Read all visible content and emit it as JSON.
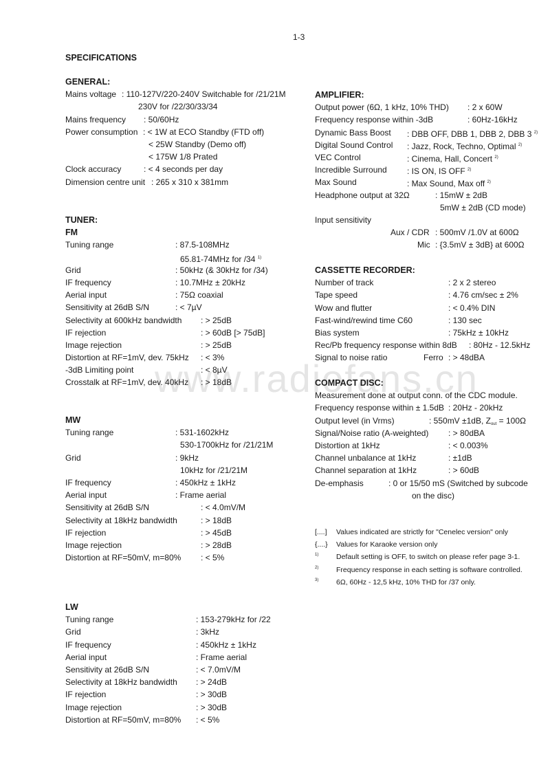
{
  "page_number": "1-3",
  "title": "SPECIFICATIONS",
  "watermark": "www.radiofans.cn",
  "general": {
    "heading": "GENERAL:",
    "rows": [
      {
        "label": "Mains voltage",
        "value": ": 110-127V/220-240V Switchable for /21/21M"
      },
      {
        "label": "",
        "value": "230V for /22/30/33/34"
      },
      {
        "label": "Mains frequency",
        "value": ": 50/60Hz"
      },
      {
        "label": "Power consumption",
        "value": ": < 1W at ECO Standby (FTD off)"
      },
      {
        "label": "",
        "value": "< 25W Standby (Demo off)"
      },
      {
        "label": "",
        "value": "< 175W 1/8 Prated"
      },
      {
        "label": "Clock accuracy",
        "value": ": < 4 seconds per day"
      },
      {
        "label": "Dimension centre unit",
        "value": ": 265 x 310 x 381mm"
      }
    ]
  },
  "tuner": {
    "heading": "TUNER:",
    "fm": {
      "heading": "FM",
      "rows": [
        {
          "label": "Tuning range",
          "value": ": 87.5-108MHz"
        },
        {
          "label": "",
          "value": "65.81-74MHz for /34",
          "note": "1)"
        },
        {
          "label": "Grid",
          "value": ": 50kHz (& 30kHz for /34)"
        },
        {
          "label": "IF frequency",
          "value": ": 10.7MHz ± 20kHz"
        },
        {
          "label": "Aerial input",
          "value": ": 75Ω coaxial"
        },
        {
          "label": "Sensitivity at 26dB S/N",
          "value": ": < 7µV"
        },
        {
          "label": "Selectivity at 600kHz bandwidth",
          "value": ": > 25dB"
        },
        {
          "label": "IF rejection",
          "value": ": > 60dB [> 75dB]"
        },
        {
          "label": "Image rejection",
          "value": ": > 25dB"
        },
        {
          "label": "Distortion at RF=1mV, dev. 75kHz",
          "value": ": < 3%"
        },
        {
          "label": "-3dB Limiting point",
          "value": ": < 8µV"
        },
        {
          "label": "Crosstalk at RF=1mV, dev. 40kHz",
          "value": ": > 18dB"
        }
      ]
    },
    "mw": {
      "heading": "MW",
      "rows": [
        {
          "label": "Tuning range",
          "value": ": 531-1602kHz"
        },
        {
          "label": "",
          "value": "530-1700kHz for /21/21M"
        },
        {
          "label": "Grid",
          "value": ": 9kHz"
        },
        {
          "label": "",
          "value": "10kHz for /21/21M"
        },
        {
          "label": "IF frequency",
          "value": ": 450kHz ± 1kHz"
        },
        {
          "label": "Aerial input",
          "value": ": Frame aerial"
        },
        {
          "label": "Sensitivity at 26dB S/N",
          "value": ": < 4.0mV/M"
        },
        {
          "label": "Selectivity at 18kHz bandwidth",
          "value": ": > 18dB"
        },
        {
          "label": "IF rejection",
          "value": ": > 45dB"
        },
        {
          "label": "Image rejection",
          "value": ": > 28dB"
        },
        {
          "label": "Distortion at RF=50mV, m=80%",
          "value": ": < 5%"
        }
      ]
    },
    "lw": {
      "heading": "LW",
      "rows": [
        {
          "label": "Tuning range",
          "value": ": 153-279kHz for /22"
        },
        {
          "label": "Grid",
          "value": ": 3kHz"
        },
        {
          "label": "IF frequency",
          "value": ": 450kHz ± 1kHz"
        },
        {
          "label": "Aerial input",
          "value": ": Frame aerial"
        },
        {
          "label": "Sensitivity at 26dB S/N",
          "value": ": < 7.0mV/M"
        },
        {
          "label": "Selectivity at 18kHz bandwidth",
          "value": ": > 24dB"
        },
        {
          "label": "IF rejection",
          "value": ": > 30dB"
        },
        {
          "label": "Image rejection",
          "value": ": > 30dB"
        },
        {
          "label": "Distortion at RF=50mV, m=80%",
          "value": ": < 5%"
        }
      ]
    }
  },
  "amplifier": {
    "heading": "AMPLIFIER:",
    "rows": [
      {
        "label": "Output power (6Ω, 1 kHz, 10% THD)",
        "value": ": 2 x 60W"
      },
      {
        "label": "Frequency response within -3dB",
        "value": ": 60Hz-16kHz"
      },
      {
        "label": "Dynamic Bass Boost",
        "value": ": DBB OFF, DBB 1, DBB 2, DBB 3",
        "note": "2)"
      },
      {
        "label": "Digital Sound Control",
        "value": ": Jazz, Rock, Techno, Optimal",
        "note": "2)"
      },
      {
        "label": "VEC Control",
        "value": ": Cinema, Hall, Concert",
        "note": "2)"
      },
      {
        "label": "Incredible Surround",
        "value": ": IS ON, IS OFF",
        "note": "2)"
      },
      {
        "label": "Max Sound",
        "value": ": Max Sound, Max off",
        "note": "2)"
      },
      {
        "label": "Headphone output at 32Ω",
        "value": ": 15mW ± 2dB"
      },
      {
        "label": "",
        "value": "5mW ± 2dB (CD mode)"
      },
      {
        "label": "Input sensitivity",
        "value": ""
      },
      {
        "label": "Aux / CDR",
        "value": ": 500mV /1.0V at 600Ω"
      },
      {
        "label": "Mic",
        "value": ": {3.5mV ± 3dB} at 600Ω"
      }
    ]
  },
  "cassette": {
    "heading": "CASSETTE RECORDER:",
    "rows": [
      {
        "label": "Number of track",
        "value": ": 2 x 2 stereo"
      },
      {
        "label": "Tape speed",
        "value": ": 4.76 cm/sec ± 2%"
      },
      {
        "label": "Wow and flutter",
        "value": ": < 0.4% DIN"
      },
      {
        "label": "Fast-wind/rewind time C60",
        "value": ": 130 sec"
      },
      {
        "label": "Bias system",
        "value": ": 75kHz ± 10kHz"
      },
      {
        "label": "Rec/Pb frequency response within 8dB",
        "value": ": 80Hz - 12.5kHz"
      },
      {
        "label": "Signal to noise ratio",
        "sublabel": "Ferro",
        "value": ": > 48dBA"
      }
    ]
  },
  "compact_disc": {
    "heading": "COMPACT DISC:",
    "rows": [
      {
        "label": "Measurement done at output conn. of the CDC module.",
        "value": ""
      },
      {
        "label": "Frequency response within ± 1.5dB",
        "value": ": 20Hz - 20kHz"
      },
      {
        "label": "Output level (in Vrms)",
        "value": ": 550mV ±1dB, Z",
        "sub": "out",
        "value_tail": " = 100Ω"
      },
      {
        "label": "Signal/Noise ratio (A-weighted)",
        "value": ": > 80dBA"
      },
      {
        "label": "Distortion at 1kHz",
        "value": ": < 0.003%"
      },
      {
        "label": "Channel unbalance at 1kHz",
        "value": ": ±1dB"
      },
      {
        "label": "Channel separation at 1kHz",
        "value": ": > 60dB"
      },
      {
        "label": "De-emphasis",
        "value": ": 0 or 15/50 mS (Switched by subcode"
      },
      {
        "label": "",
        "value": "on the disc)"
      }
    ]
  },
  "footnotes": [
    {
      "marker": "[....]",
      "text": "Values indicated are strictly for \"Cenelec version\" only"
    },
    {
      "marker": "{....}",
      "text": "Values for Karaoke version only"
    },
    {
      "marker": "1)",
      "text": "Default setting is OFF, to switch on please refer page 3-1."
    },
    {
      "marker": "2)",
      "text": "Frequency response in each setting is software controlled."
    },
    {
      "marker": "3)",
      "text": "6Ω, 60Hz - 12,5 kHz, 10% THD for /37 only."
    }
  ]
}
